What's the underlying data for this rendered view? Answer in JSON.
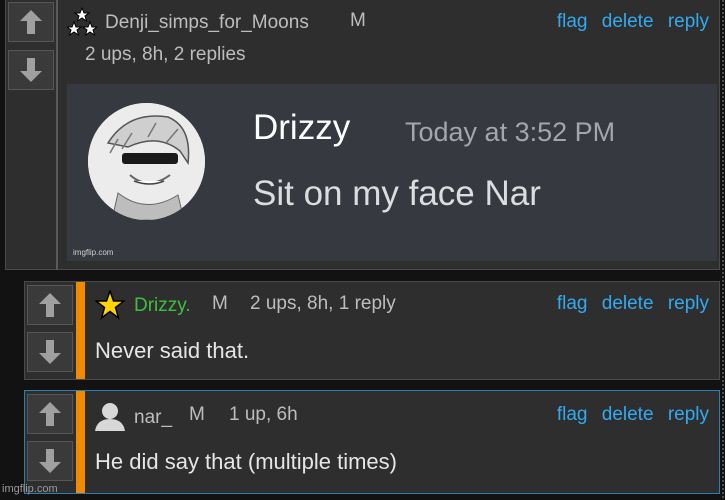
{
  "comments": [
    {
      "username": "Denji_simps_for_Moons",
      "gender": "M",
      "meta": "2 ups, 8h, 2 replies",
      "actions": {
        "flag": "flag",
        "delete": "delete",
        "reply": "reply"
      },
      "avatar_icon": "three-stars-icon",
      "embed": {
        "user": "Drizzy",
        "time": "Today at 3:52 PM",
        "message": "Sit on my face Nar",
        "watermark": "imgflip.com"
      }
    },
    {
      "username": "Drizzy.",
      "username_color": "#3fbf3f",
      "gender": "M",
      "meta": "2 ups, 8h, 1 reply",
      "text": "Never said that.",
      "actions": {
        "flag": "flag",
        "delete": "delete",
        "reply": "reply"
      },
      "avatar_icon": "gold-star-icon"
    },
    {
      "username": "nar_",
      "gender": "M",
      "meta": "1 up, 6h",
      "text": "He did say that (multiple times)",
      "actions": {
        "flag": "flag",
        "delete": "delete",
        "reply": "reply"
      },
      "avatar_icon": "user-silhouette-icon"
    }
  ],
  "footer_watermark": "imgflip.com",
  "colors": {
    "link": "#33aaf0",
    "reply_bar": "#f08a00",
    "highlight_border": "#2b7fb0"
  }
}
